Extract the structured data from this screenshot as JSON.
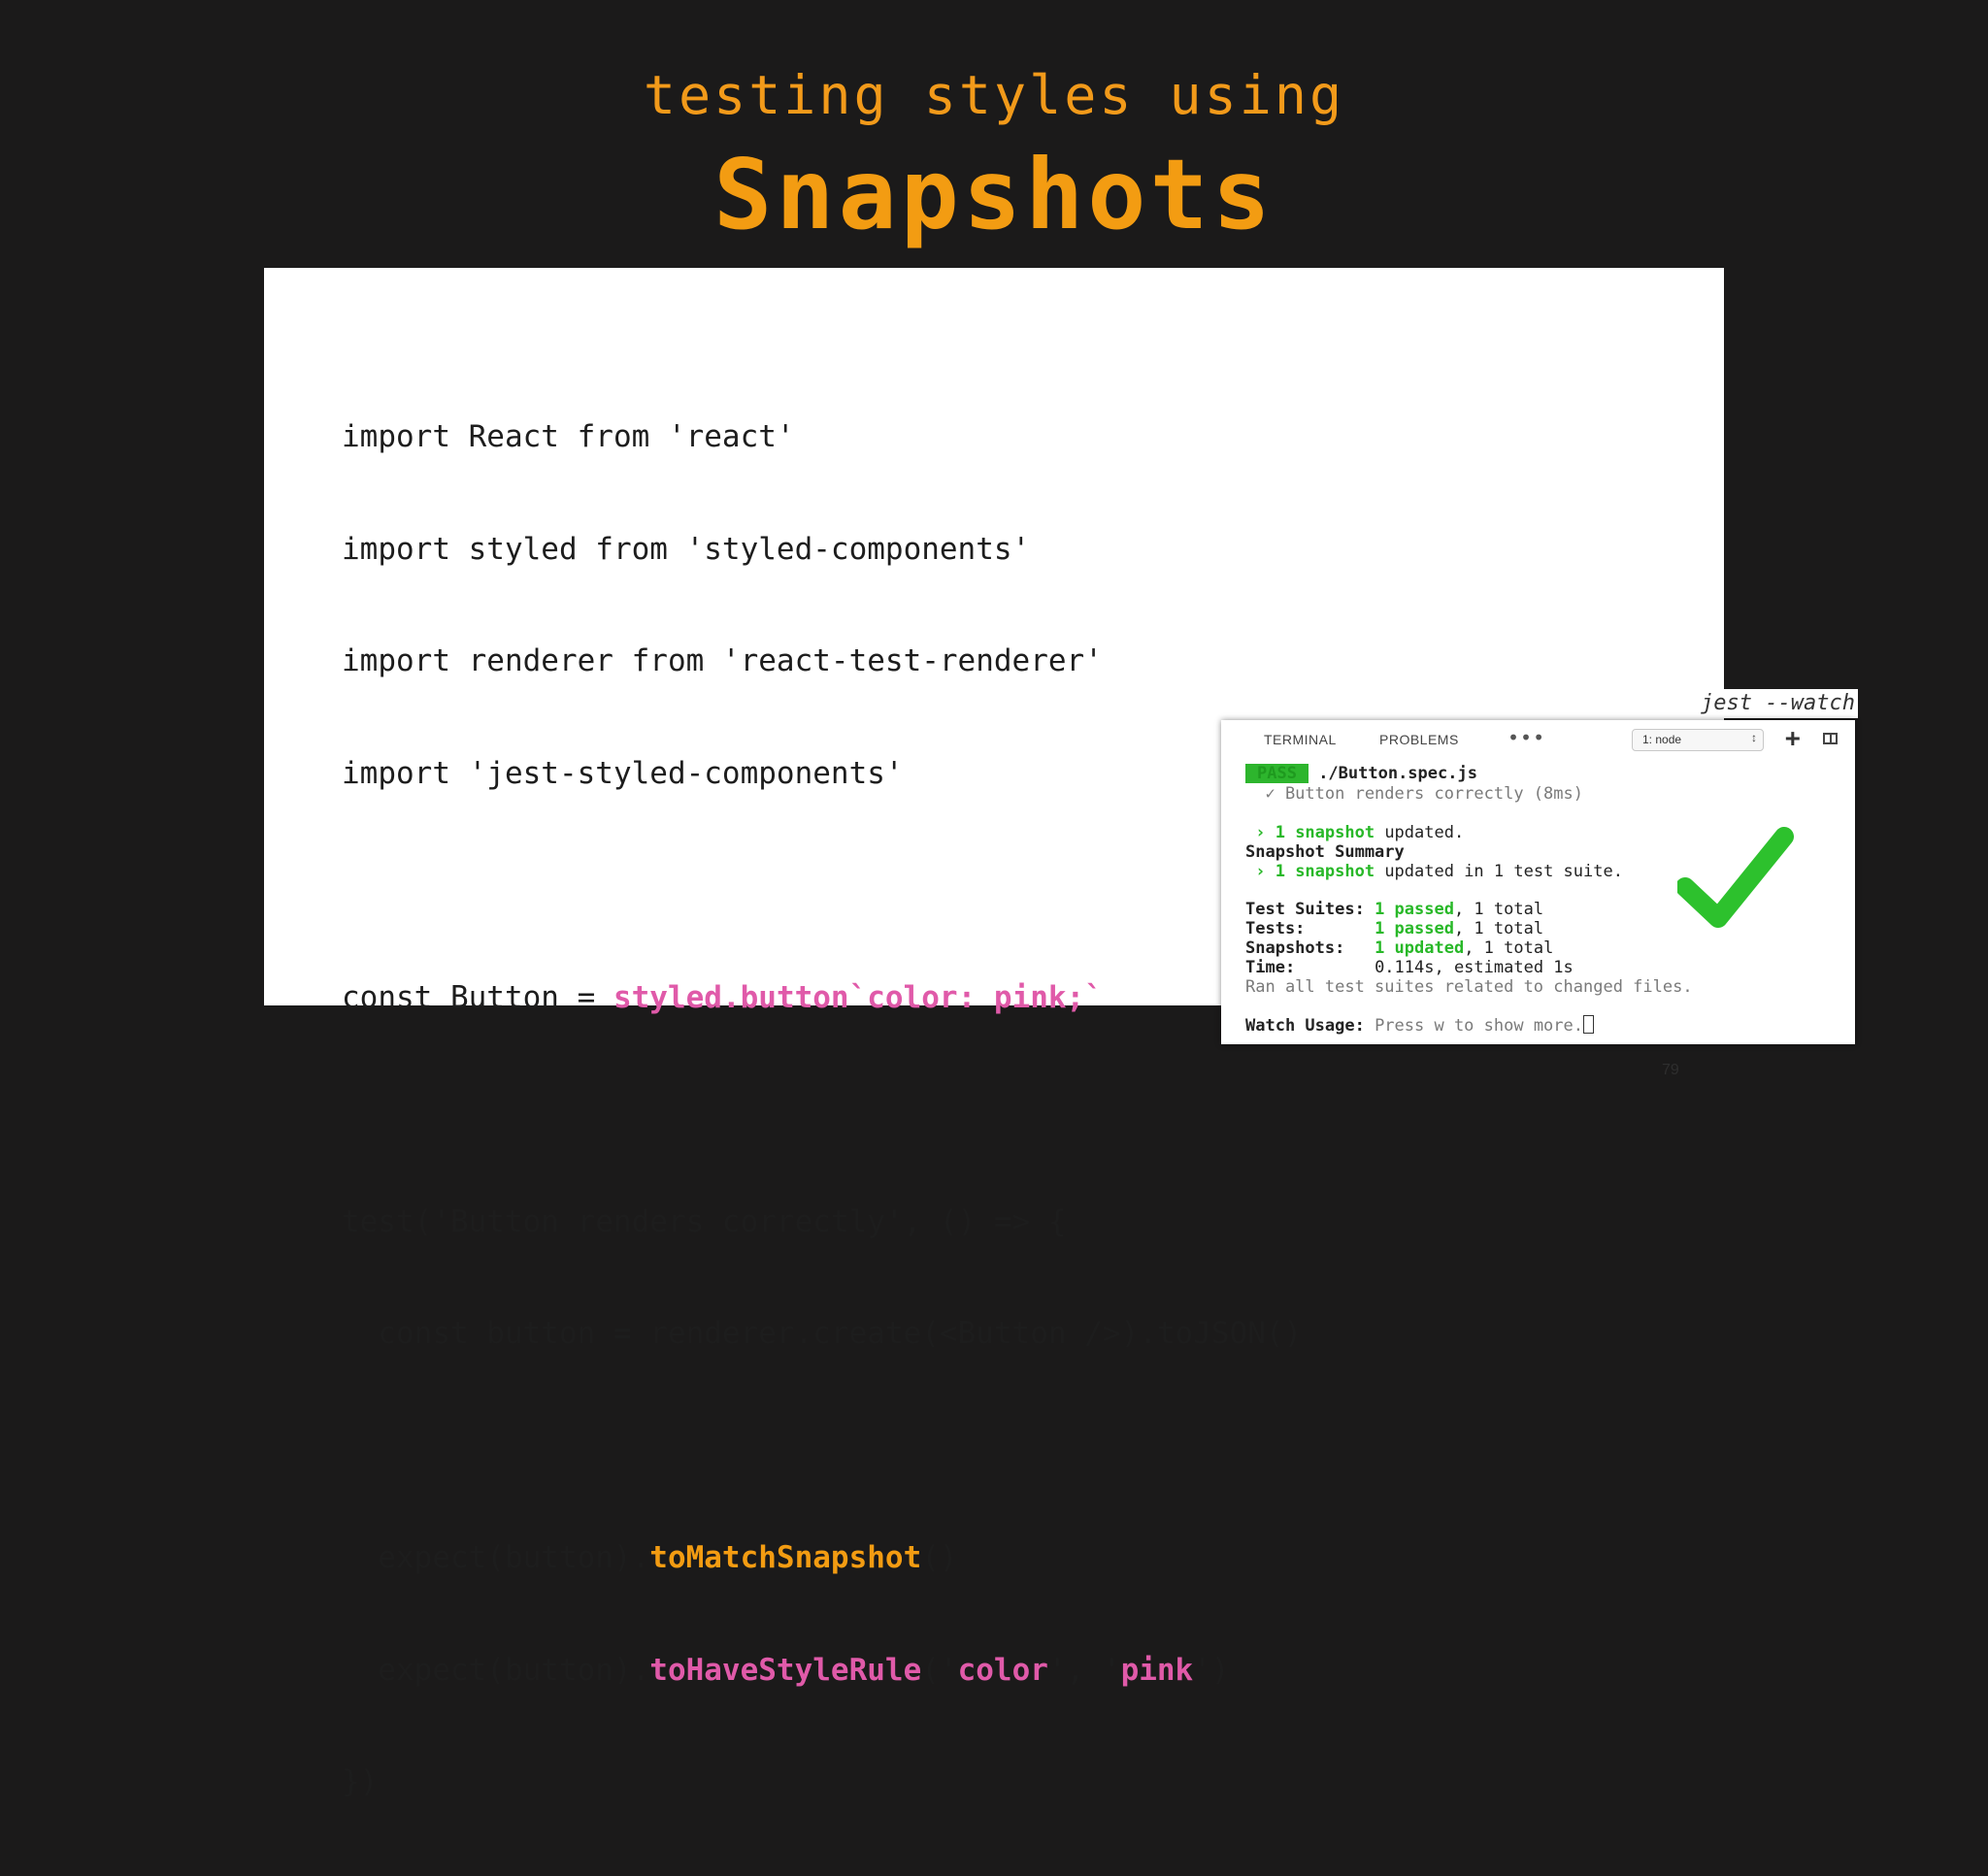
{
  "slide": {
    "subtitle": "testing styles using",
    "title": "Snapshots",
    "page_number": "79"
  },
  "code": {
    "l1": "import React from 'react'",
    "l2": "import styled from 'styled-components'",
    "l3": "import renderer from 'react-test-renderer'",
    "l4": "import 'jest-styled-components'",
    "l5_a": "const Button = ",
    "l5_b": "styled.button`color: pink;`",
    "l6": "test('Button renders correctly', () => {",
    "l7": "  const button = renderer.create(<Button />).toJSON()",
    "l8_a": "  expect(button).",
    "l8_b": "toMatchSnapshot",
    "l8_c": "()",
    "l9_a": "  expect(button).",
    "l9_b": "toHaveStyleRule",
    "l9_c": "('",
    "l9_d": "color",
    "l9_e": "', '",
    "l9_f": "pink",
    "l9_g": "')",
    "l10": "})"
  },
  "terminal": {
    "watch_label": "jest --watch",
    "tab_terminal": "TERMINAL",
    "tab_problems": "PROBLEMS",
    "more": "•••",
    "select_value": "1: node",
    "select_arrow": "↕",
    "plus": "+",
    "pass_badge": "PASS",
    "spec_file": " ./Button.spec.js",
    "test_line": "  ✓ Button renders correctly (8ms)",
    "snap_updated_arrow": " › ",
    "snap_updated_count": "1 snapshot",
    "snap_updated_rest": " updated.",
    "summary_title": "Snapshot Summary",
    "summary_arrow": " › ",
    "summary_count": "1 snapshot",
    "summary_rest": " updated in 1 test suite.",
    "suites_label": "Test Suites: ",
    "suites_val": "1 passed",
    "suites_rest": ", 1 total",
    "tests_label": "Tests:       ",
    "tests_val": "1 passed",
    "tests_rest": ", 1 total",
    "snaps_label": "Snapshots:   ",
    "snaps_val": "1 updated",
    "snaps_rest": ", 1 total",
    "time_label": "Time:        ",
    "time_val": "0.114s, estimated 1s",
    "ran_all": "Ran all test suites related to changed files.",
    "watch_usage_label": "Watch Usage: ",
    "watch_usage_text": "Press w to show more."
  },
  "colors": {
    "background": "#1b1a1a",
    "title_orange": "#f39c12",
    "code_pink": "#e05aa9",
    "terminal_green": "#28b828"
  }
}
